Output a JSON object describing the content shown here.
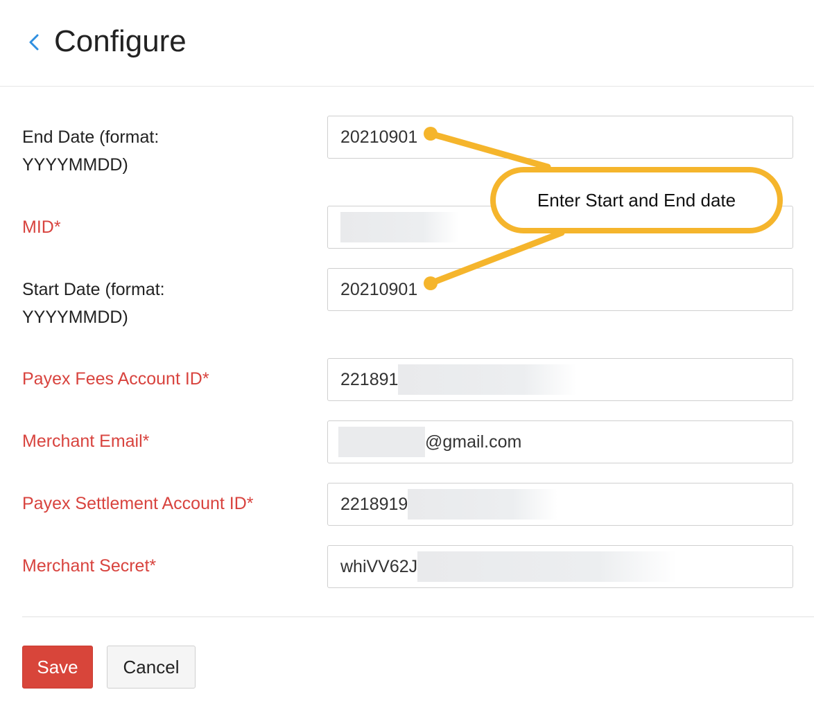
{
  "header": {
    "title": "Configure",
    "back_icon": "chevron-left-icon"
  },
  "form": {
    "end_date": {
      "label_line1": "End Date (format:",
      "label_line2": "YYYYMMDD)",
      "value": "20210901"
    },
    "mid": {
      "label": "MID*",
      "value": ""
    },
    "start_date": {
      "label_line1": "Start Date (format:",
      "label_line2": "YYYYMMDD)",
      "value": "20210901"
    },
    "payex_fees_account_id": {
      "label": "Payex Fees Account ID*",
      "value": "221891"
    },
    "merchant_email": {
      "label": "Merchant Email*",
      "value": "@gmail.com"
    },
    "payex_settlement_account_id": {
      "label": "Payex Settlement Account ID*",
      "value": "2218919"
    },
    "merchant_secret": {
      "label": "Merchant Secret*",
      "value": "whiVV62J"
    }
  },
  "actions": {
    "save_label": "Save",
    "cancel_label": "Cancel"
  },
  "annotation": {
    "text": "Enter Start and End date",
    "color": "#f5b52c"
  },
  "colors": {
    "required_label": "#d8433e",
    "save_button": "#d8453a",
    "back_icon": "#2f8fe0"
  }
}
